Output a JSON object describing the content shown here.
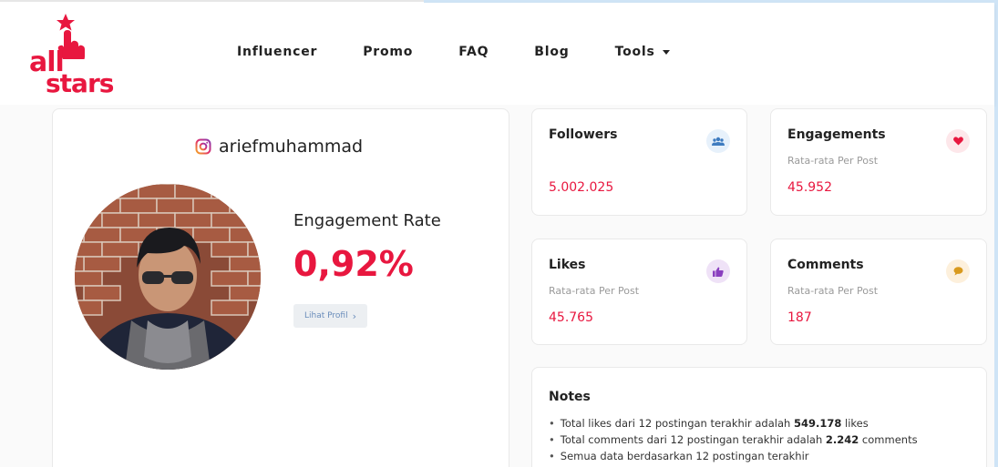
{
  "header": {
    "logo_top": "all",
    "logo_bottom": "stars",
    "nav": [
      {
        "label": "Influencer"
      },
      {
        "label": "Promo"
      },
      {
        "label": "FAQ"
      },
      {
        "label": "Blog"
      },
      {
        "label": "Tools"
      }
    ]
  },
  "profile": {
    "username": "ariefmuhammad",
    "engagement_rate_label": "Engagement Rate",
    "engagement_rate_value": "0,92%",
    "view_profile_label": "Lihat Profil",
    "view_profile_chevron": "›"
  },
  "stats": {
    "followers": {
      "title": "Followers",
      "value": "5.002.025",
      "icon": "users-icon",
      "icon_bg": "#e7f1fb",
      "icon_color": "#3f7cc0"
    },
    "engagements": {
      "title": "Engagements",
      "subtitle": "Rata-rata Per Post",
      "value": "45.952",
      "icon": "heart-icon",
      "icon_bg": "#fde7ea",
      "icon_color": "#e8173f"
    },
    "likes": {
      "title": "Likes",
      "subtitle": "Rata-rata Per Post",
      "value": "45.765",
      "icon": "thumbs-up-icon",
      "icon_bg": "#efe2f7",
      "icon_color": "#8a3fbf"
    },
    "comments": {
      "title": "Comments",
      "subtitle": "Rata-rata Per Post",
      "value": "187",
      "icon": "comment-icon",
      "icon_bg": "#fdf0dc",
      "icon_color": "#d99a1e"
    }
  },
  "notes": {
    "title": "Notes",
    "line1_prefix": "Total likes dari 12 postingan terakhir adalah ",
    "line1_value": "549.178",
    "line1_suffix": " likes",
    "line2_prefix": "Total comments dari 12 postingan terakhir adalah ",
    "line2_value": "2.242",
    "line2_suffix": " comments",
    "line3": "Semua data berdasarkan 12 postingan terakhir"
  },
  "colors": {
    "accent": "#e8173f"
  }
}
